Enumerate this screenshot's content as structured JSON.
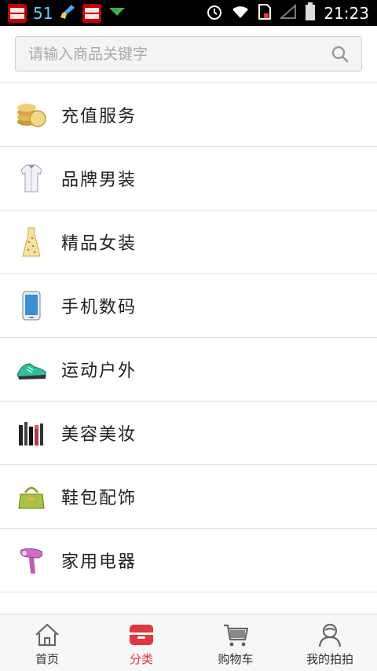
{
  "status_bar": {
    "left_number": "51",
    "time": "21:23"
  },
  "search": {
    "placeholder": "请输入商品关键字"
  },
  "categories": [
    {
      "label": "充值服务",
      "icon": "coins-icon"
    },
    {
      "label": "品牌男装",
      "icon": "shirt-icon"
    },
    {
      "label": "精品女装",
      "icon": "dress-icon"
    },
    {
      "label": "手机数码",
      "icon": "phone-icon"
    },
    {
      "label": "运动户外",
      "icon": "sneaker-icon"
    },
    {
      "label": "美容美妆",
      "icon": "cosmetics-icon"
    },
    {
      "label": "鞋包配饰",
      "icon": "handbag-icon"
    },
    {
      "label": "家用电器",
      "icon": "hairdryer-icon"
    },
    {
      "label": "",
      "icon": "partial-item-icon"
    }
  ],
  "tabbar": {
    "tabs": [
      {
        "label": "首页",
        "icon": "home-icon",
        "active": false
      },
      {
        "label": "分类",
        "icon": "category-icon",
        "active": true
      },
      {
        "label": "购物车",
        "icon": "cart-icon",
        "active": false
      },
      {
        "label": "我的拍拍",
        "icon": "user-icon",
        "active": false
      }
    ]
  },
  "colors": {
    "accent": "#e0383e",
    "statusbar_bg": "#000000"
  }
}
